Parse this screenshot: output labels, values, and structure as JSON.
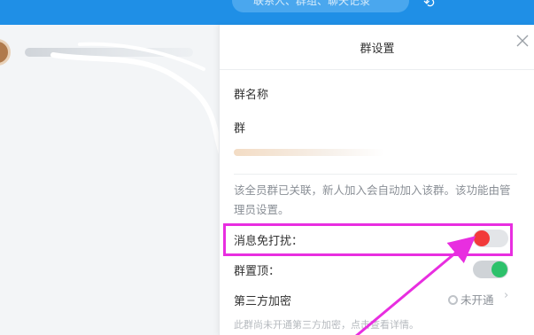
{
  "topbar": {
    "search_placeholder": "联系人、群组、聊天记录",
    "icon": "history-icon"
  },
  "panel": {
    "title": "群设置",
    "group_name_label": "群名称",
    "group_label": "群",
    "description": "该全员群已关联，新人加入会自动加入该群。该功能由管理员设置。",
    "dnd_label": "消息免打扰：",
    "dnd_enabled": false,
    "pin_label": "群置顶：",
    "pin_enabled": true,
    "encryption_label": "第三方加密",
    "encryption_status": "未开通",
    "encryption_note": "此群尚未开通第三方加密，点击查看详情。"
  },
  "colors": {
    "brand_blue": "#1f8fe6",
    "toggle_off_knob": "#f23a3a",
    "toggle_on_knob": "#2dc16b",
    "annotation_magenta": "#e82ee0"
  }
}
